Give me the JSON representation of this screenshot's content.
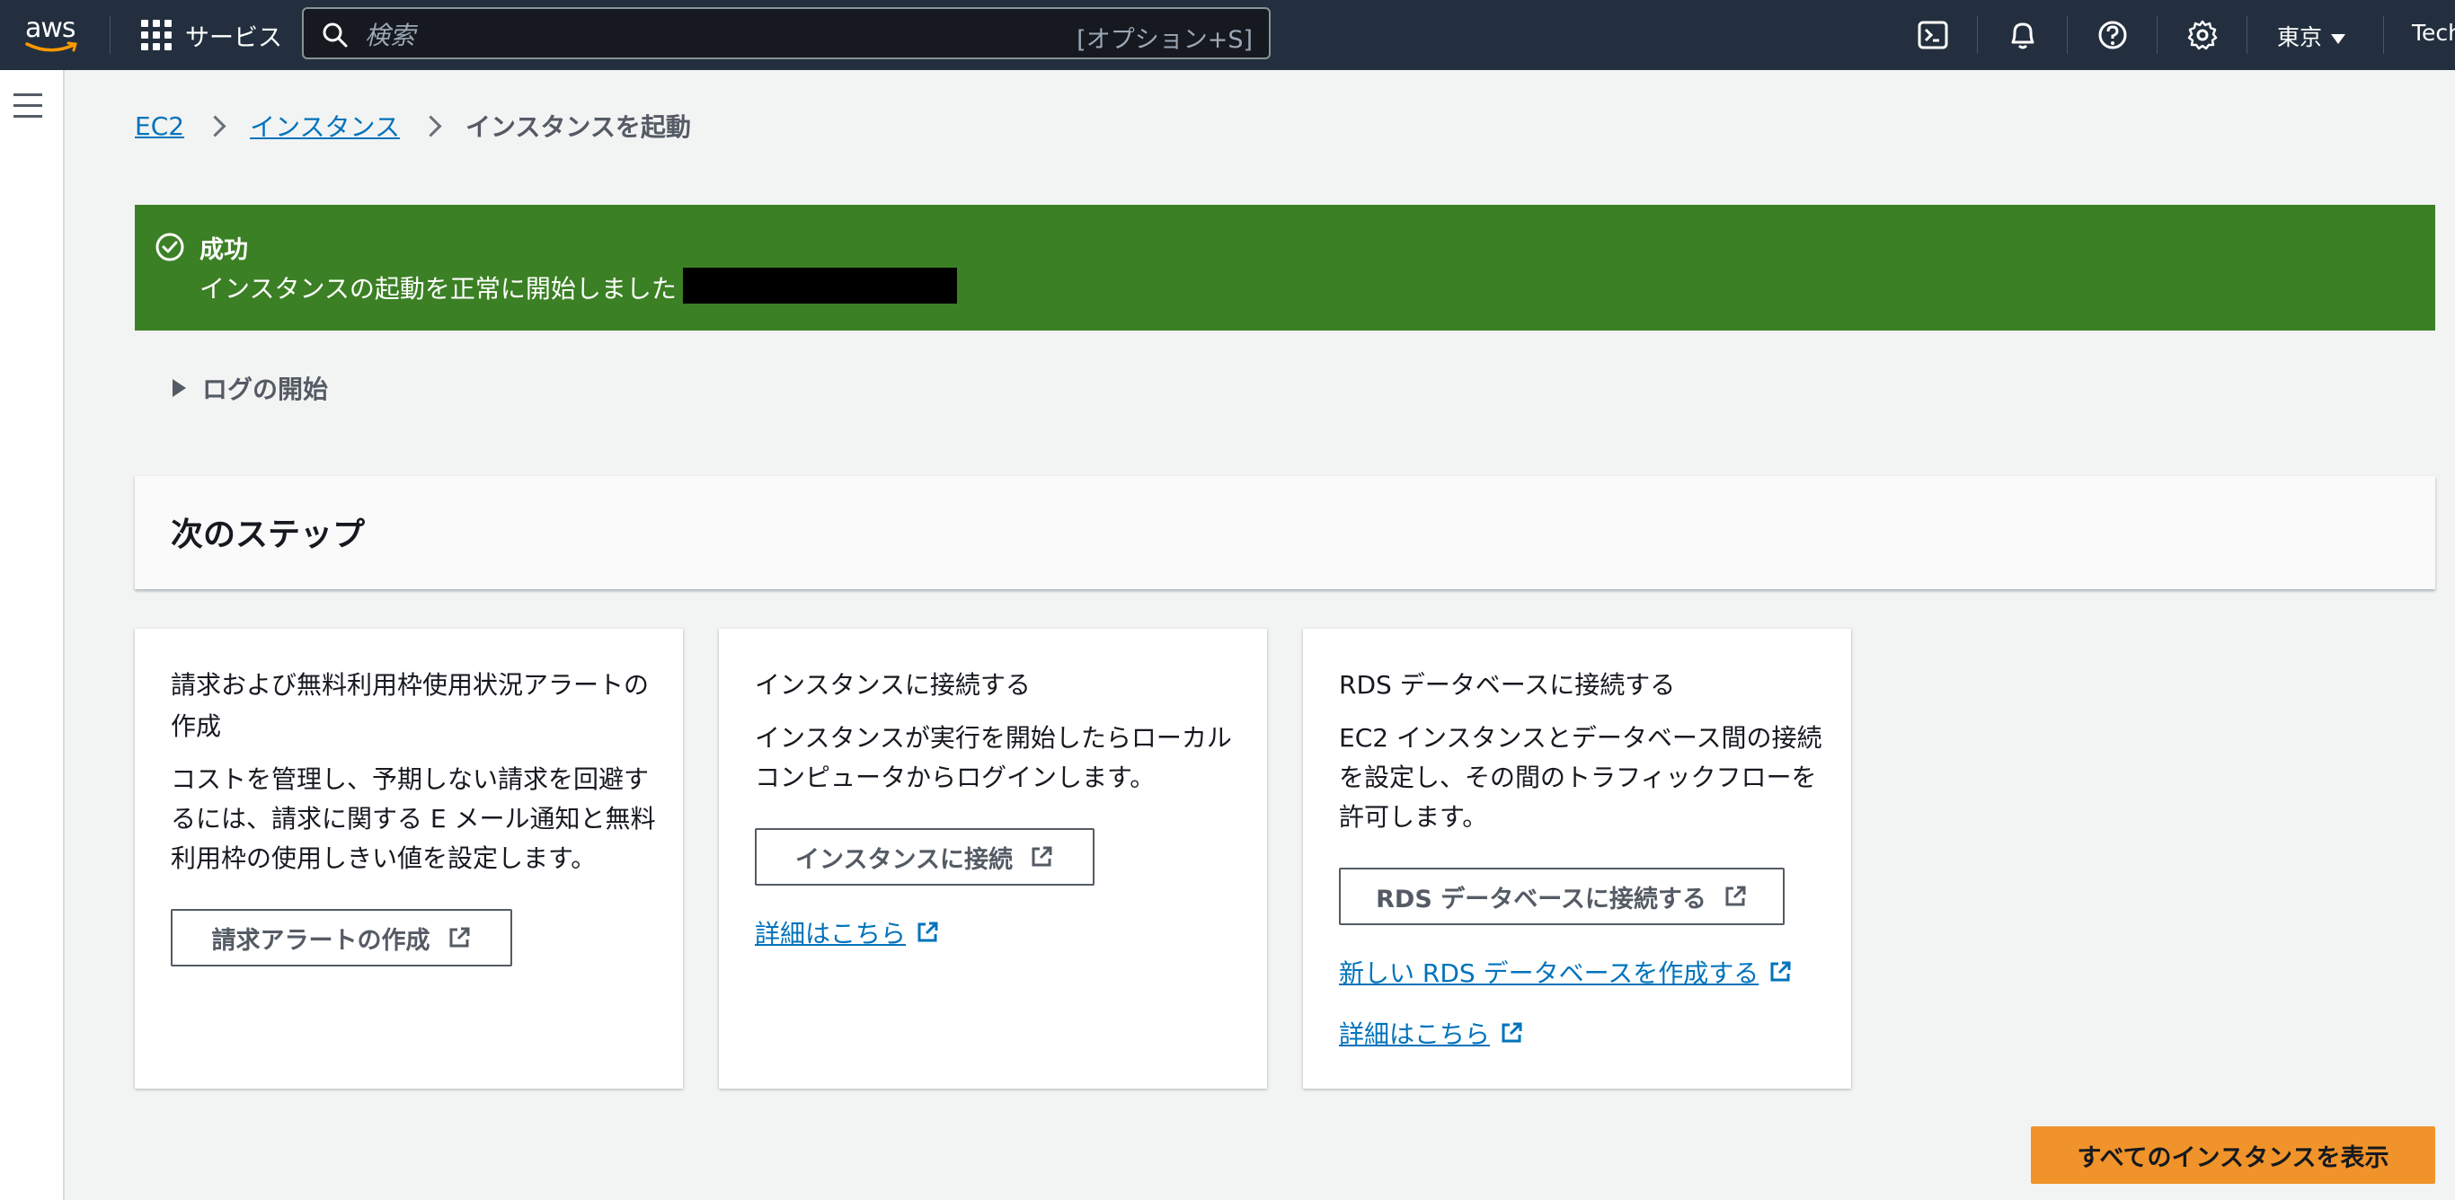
{
  "topnav": {
    "logo_text": "aws",
    "services_label": "サービス",
    "search_placeholder": "検索",
    "search_shortcut": "[オプション+S]",
    "region": "東京",
    "account": "Tech"
  },
  "breadcrumb": {
    "ec2": "EC2",
    "instances": "インスタンス",
    "current": "インスタンスを起動"
  },
  "flash": {
    "title": "成功",
    "message": "インスタンスの起動を正常に開始しました"
  },
  "log_toggle": "ログの開始",
  "next_steps": {
    "title": "次のステップ",
    "cards": [
      {
        "title": "請求および無料利用枠使用状況アラートの作成",
        "description": "コストを管理し、予期しない請求を回避するには、請求に関する E メール通知と無料利用枠の使用しきい値を設定します。",
        "button": "請求アラートの作成"
      },
      {
        "title": "インスタンスに接続する",
        "description": "インスタンスが実行を開始したらローカルコンピュータからログインします。",
        "button": "インスタンスに接続",
        "link": "詳細はこちら"
      },
      {
        "title": "RDS データベースに接続する",
        "description": "EC2 インスタンスとデータベース間の接続を設定し、その間のトラフィックフローを許可します。",
        "button": "RDS データベースに接続する",
        "link1": "新しい RDS データベースを作成する",
        "link2": "詳細はこちら"
      }
    ]
  },
  "view_all_button": "すべてのインスタンスを表示",
  "colors": {
    "nav_bg": "#232f3e",
    "success": "#3b8024",
    "link": "#0073bb",
    "primary": "#f0932a"
  }
}
